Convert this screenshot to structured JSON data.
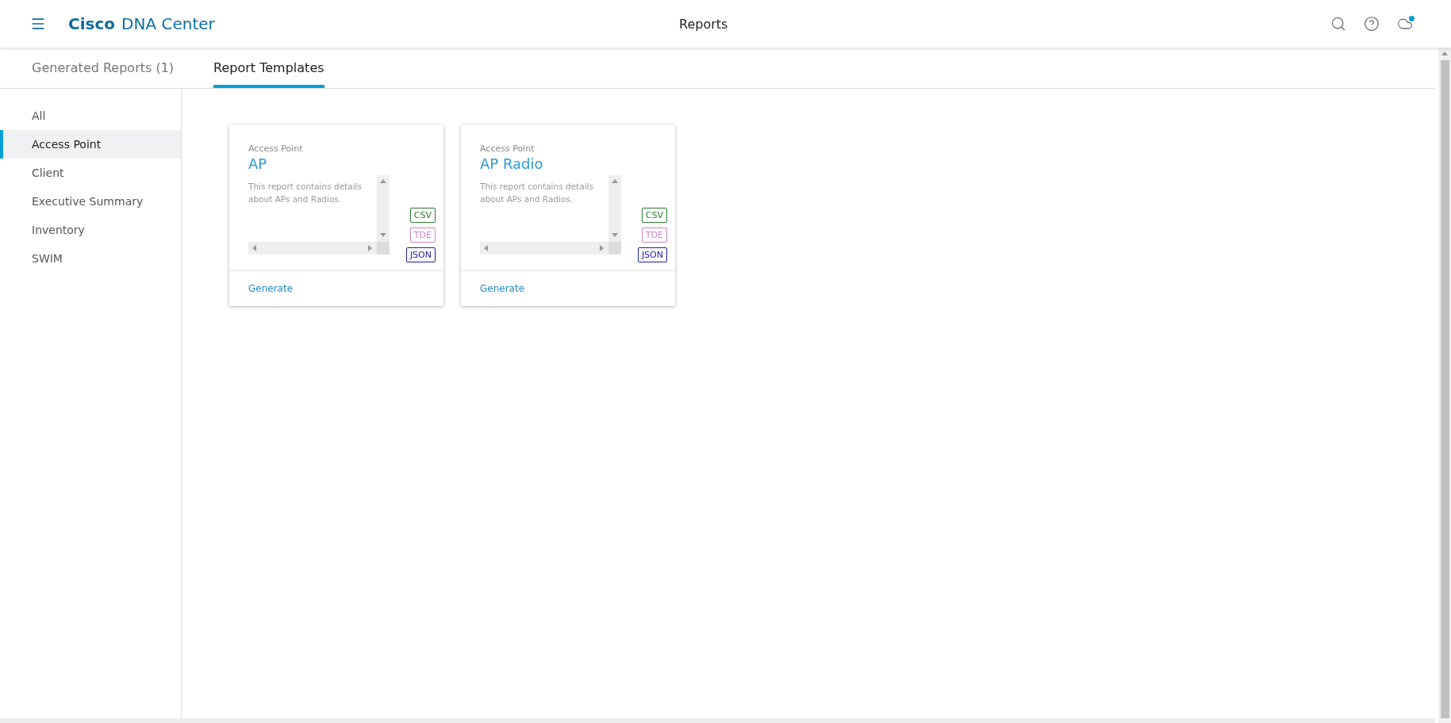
{
  "header": {
    "brand_bold": "Cisco",
    "brand_rest": "DNA Center",
    "title": "Reports",
    "notification_dot": true
  },
  "tabs": [
    {
      "label": "Generated Reports (1)",
      "selected": false
    },
    {
      "label": "Report Templates",
      "selected": true
    }
  ],
  "sidebar": {
    "items": [
      {
        "label": "All",
        "selected": false
      },
      {
        "label": "Access Point",
        "selected": true
      },
      {
        "label": "Client",
        "selected": false
      },
      {
        "label": "Executive Summary",
        "selected": false
      },
      {
        "label": "Inventory",
        "selected": false
      },
      {
        "label": "SWIM",
        "selected": false
      }
    ]
  },
  "cards": [
    {
      "category": "Access Point",
      "title": "AP",
      "description": "This report contains details about APs and Radios.",
      "formats": [
        {
          "label": "CSV",
          "color": "#2e7d32"
        },
        {
          "label": "TDE",
          "color": "#c586c0"
        },
        {
          "label": "JSON",
          "color": "#1a1aa6"
        }
      ],
      "action": "Generate"
    },
    {
      "category": "Access Point",
      "title": "AP Radio",
      "description": "This report contains details about APs and Radios.",
      "formats": [
        {
          "label": "CSV",
          "color": "#2e7d32"
        },
        {
          "label": "TDE",
          "color": "#c586c0"
        },
        {
          "label": "JSON",
          "color": "#1a1aa6"
        }
      ],
      "action": "Generate"
    }
  ]
}
